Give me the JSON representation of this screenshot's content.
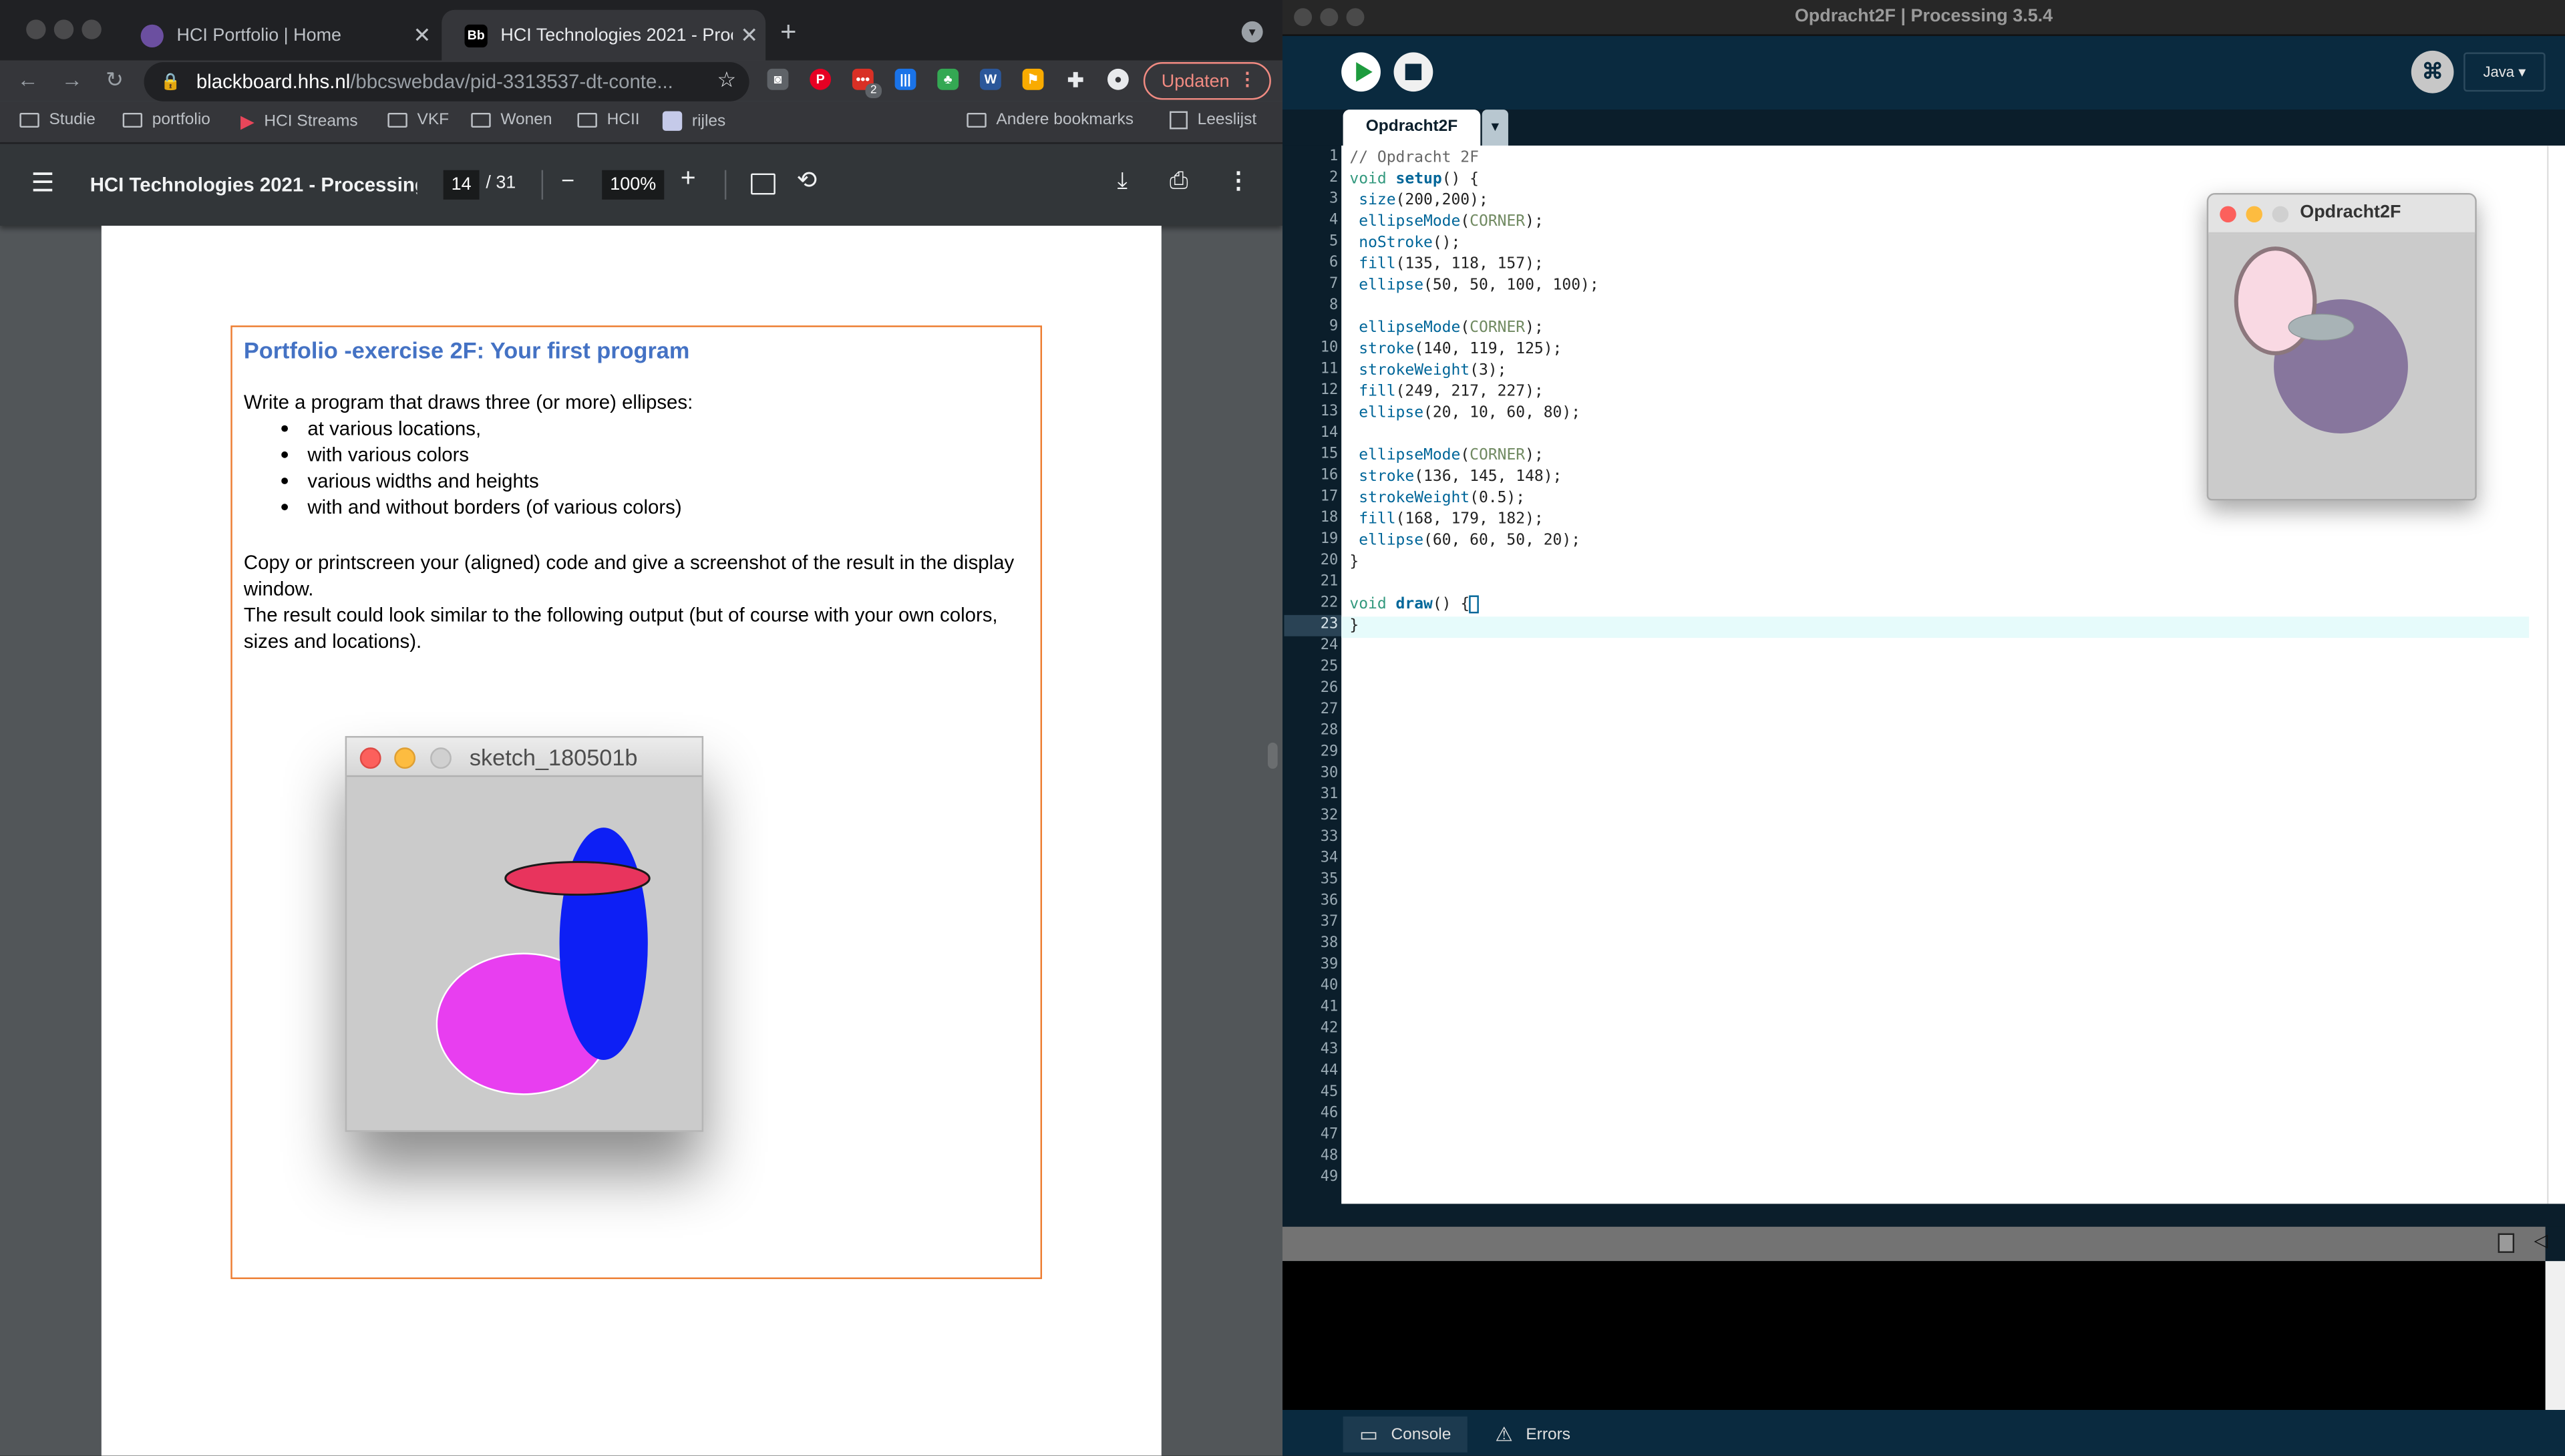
{
  "browser": {
    "tabs": [
      {
        "title": "HCI Portfolio | Home",
        "icon": "portfolio-favicon"
      },
      {
        "title": "HCI Technologies 2021 - Proce",
        "icon": "blackboard-favicon",
        "icon_text": "Bb"
      }
    ],
    "url_host": "blackboard.hhs.nl",
    "url_path": "/bbcswebdav/pid-3313537-dt-conte...",
    "extension_badge": "2",
    "update_button": "Updaten",
    "bookmarks": [
      "Studie",
      "portfolio",
      "HCI Streams",
      "VKF",
      "Wonen",
      "HCII",
      "rijles",
      "Andere bookmarks",
      "Leeslijst"
    ]
  },
  "pdf": {
    "title": "HCI Technologies 2021 - Processing ...",
    "current_page": "14",
    "total_pages": "/ 31",
    "zoom": "100%"
  },
  "document": {
    "heading": "Portfolio -exercise 2F: Your first program",
    "intro": "Write a program that draws three (or more) ellipses:",
    "bullets": [
      "at various locations,",
      "with various colors",
      "various widths and heights",
      "with and without borders (of various colors)"
    ],
    "para1": "Copy or printscreen your (aligned) code and give a screenshot of the result in the display window.",
    "para2": "The result could look similar to the following output (but of course with your own colors, sizes and locations).",
    "sketch_title": "sketch_180501b"
  },
  "processing": {
    "window_title": "Opdracht2F | Processing 3.5.4",
    "mode": "Java ▾",
    "tab_name": "Opdracht2F",
    "current_line": 23,
    "code_lines": [
      "// Opdracht 2F",
      "void setup() {",
      " size(200,200);",
      " ellipseMode(CORNER);",
      " noStroke();",
      " fill(135, 118, 157);",
      " ellipse(50, 50, 100, 100);",
      "",
      " ellipseMode(CORNER);",
      " stroke(140, 119, 125);",
      " strokeWeight(3);",
      " fill(249, 217, 227);",
      " ellipse(20, 10, 60, 80);",
      "",
      " ellipseMode(CORNER);",
      " stroke(136, 145, 148);",
      " strokeWeight(0.5);",
      " fill(168, 179, 182);",
      " ellipse(60, 60, 50, 20);",
      "}",
      "",
      "void draw() {",
      "}"
    ],
    "total_lines": 49,
    "sketch_window_title": "Opdracht2F",
    "console_tab": "Console",
    "errors_tab": "Errors"
  },
  "colors": {
    "exercise_border": "#ed7d31",
    "heading_blue": "#4472c4",
    "processing_bg": "#0b1e2b"
  }
}
